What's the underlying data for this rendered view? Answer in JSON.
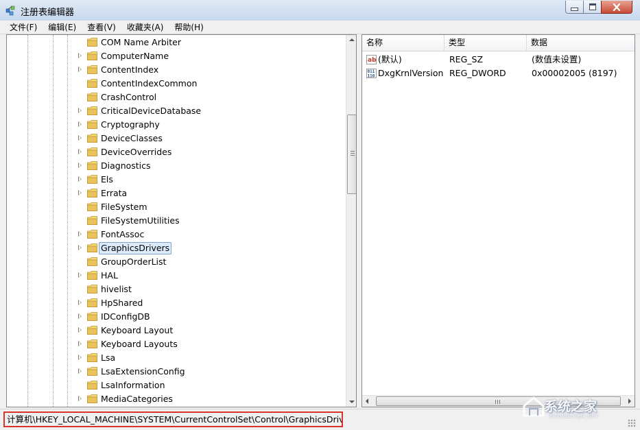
{
  "window": {
    "title": "注册表编辑器",
    "icons": {
      "app": "registry-editor-icon",
      "minimize": "minimize-icon",
      "maximize": "maximize-icon",
      "close": "close-icon"
    }
  },
  "menu": {
    "items": [
      "文件(F)",
      "编辑(E)",
      "查看(V)",
      "收藏夹(A)",
      "帮助(H)"
    ]
  },
  "tree": {
    "selected_index": 15,
    "items": [
      {
        "label": "COM Name Arbiter",
        "has_children": false
      },
      {
        "label": "ComputerName",
        "has_children": true
      },
      {
        "label": "ContentIndex",
        "has_children": true
      },
      {
        "label": "ContentIndexCommon",
        "has_children": false
      },
      {
        "label": "CrashControl",
        "has_children": false
      },
      {
        "label": "CriticalDeviceDatabase",
        "has_children": true
      },
      {
        "label": "Cryptography",
        "has_children": true
      },
      {
        "label": "DeviceClasses",
        "has_children": true
      },
      {
        "label": "DeviceOverrides",
        "has_children": true
      },
      {
        "label": "Diagnostics",
        "has_children": true
      },
      {
        "label": "Els",
        "has_children": true
      },
      {
        "label": "Errata",
        "has_children": true
      },
      {
        "label": "FileSystem",
        "has_children": false
      },
      {
        "label": "FileSystemUtilities",
        "has_children": false
      },
      {
        "label": "FontAssoc",
        "has_children": true
      },
      {
        "label": "GraphicsDrivers",
        "has_children": true
      },
      {
        "label": "GroupOrderList",
        "has_children": false
      },
      {
        "label": "HAL",
        "has_children": true
      },
      {
        "label": "hivelist",
        "has_children": false
      },
      {
        "label": "HpShared",
        "has_children": true
      },
      {
        "label": "IDConfigDB",
        "has_children": true
      },
      {
        "label": "Keyboard Layout",
        "has_children": true
      },
      {
        "label": "Keyboard Layouts",
        "has_children": true
      },
      {
        "label": "Lsa",
        "has_children": true
      },
      {
        "label": "LsaExtensionConfig",
        "has_children": true
      },
      {
        "label": "LsaInformation",
        "has_children": false
      },
      {
        "label": "MediaCategories",
        "has_children": true
      }
    ],
    "icons": {
      "folder": "folder-icon",
      "expander": "expand-arrow-icon"
    }
  },
  "values": {
    "columns": {
      "name": "名称",
      "type": "类型",
      "data": "数据"
    },
    "rows": [
      {
        "icon": "string-value-icon",
        "name": "(默认)",
        "type": "REG_SZ",
        "data": "(数值未设置)"
      },
      {
        "icon": "binary-value-icon",
        "name": "DxgKrnlVersion",
        "type": "REG_DWORD",
        "data": "0x00002005 (8197)"
      }
    ],
    "string_icon_text": "ab",
    "binary_icon_text": "011\n110"
  },
  "statusbar": {
    "path": "计算机\\HKEY_LOCAL_MACHINE\\SYSTEM\\CurrentControlSet\\Control\\GraphicsDrivers",
    "highlight_color": "#d9342b"
  },
  "watermark": {
    "text": "系统之家",
    "sub": "XITONGZHIJIA.NET"
  },
  "colors": {
    "selection_bg": "#dcebfc",
    "selection_border": "#7da2ce",
    "folder_yellow": "#e8c25a"
  }
}
